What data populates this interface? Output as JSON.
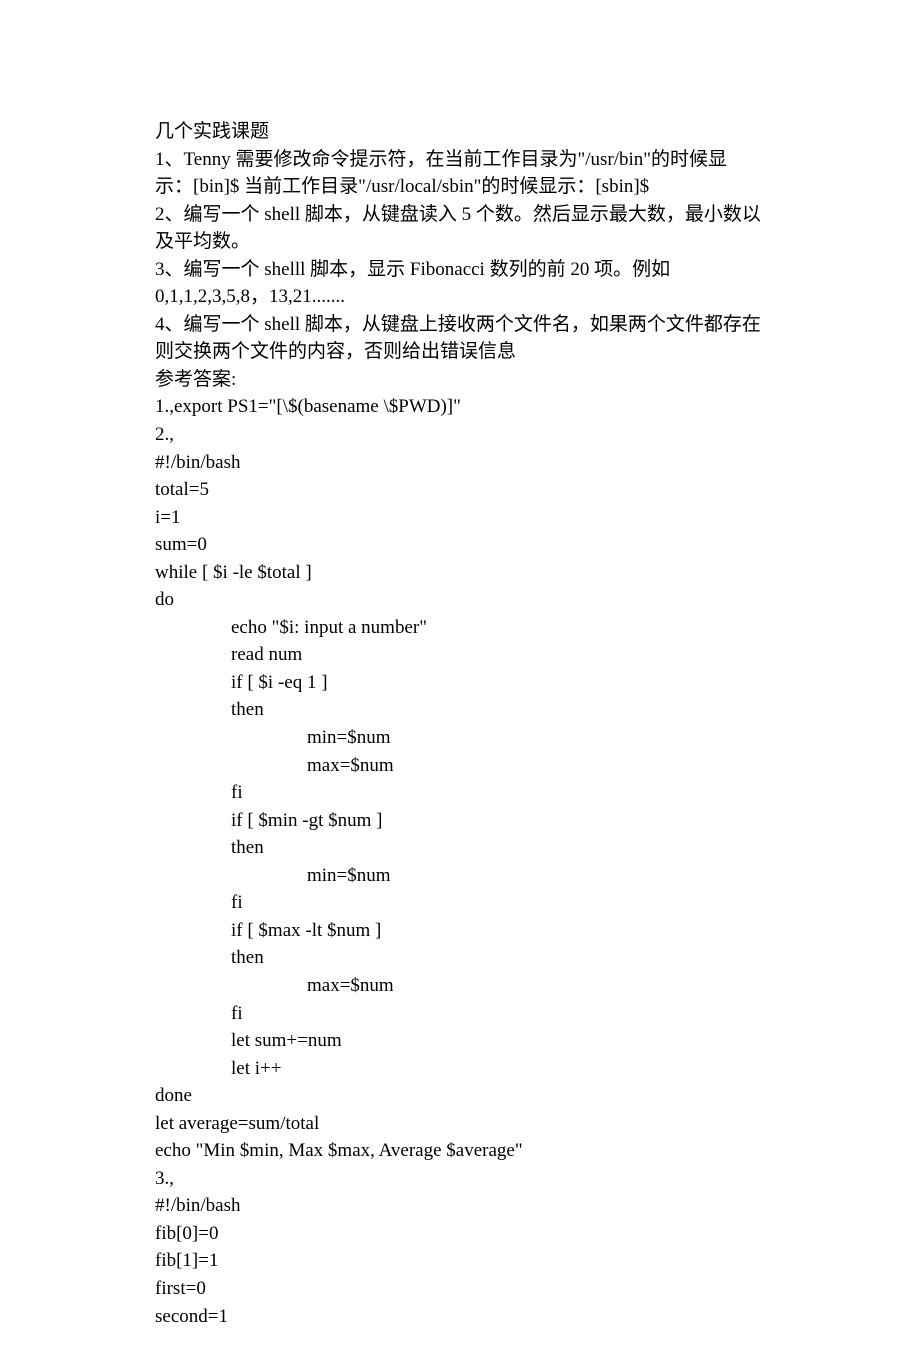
{
  "heading": "几个实践课题",
  "q1": "1、Tenny 需要修改命令提示符，在当前工作目录为\"/usr/bin\"的时候显示：[bin]$ 当前工作目录\"/usr/local/sbin\"的时候显示：[sbin]$",
  "q2": "2、编写一个 shell 脚本，从键盘读入 5 个数。然后显示最大数，最小数以及平均数。",
  "q3": "3、编写一个 shelll 脚本，显示 Fibonacci 数列的前 20 项。例如 0,1,1,2,3,5,8，13,21.......",
  "q4": "4、编写一个 shell 脚本，从键盘上接收两个文件名，如果两个文件都存在则交换两个文件的内容，否则给出错误信息",
  "ans_label": "参考答案:",
  "a1_label": "1.,export PS1=\"[\\$(basename \\$PWD)]\"",
  "a2_label": "2.,",
  "code2": "#!/bin/bash\ntotal=5\ni=1\nsum=0\nwhile [ $i -le $total ]\ndo\n                echo \"$i: input a number\"\n                read num\n                if [ $i -eq 1 ]\n                then\n                                min=$num\n                                max=$num\n                fi\n                if [ $min -gt $num ]\n                then\n                                min=$num\n                fi\n                if [ $max -lt $num ]\n                then\n                                max=$num\n                fi\n                let sum+=num\n                let i++\ndone\nlet average=sum/total\necho \"Min $min, Max $max, Average $average\"",
  "a3_label": "3.,",
  "code3": "#!/bin/bash\nfib[0]=0\nfib[1]=1\nfirst=0\nsecond=1"
}
